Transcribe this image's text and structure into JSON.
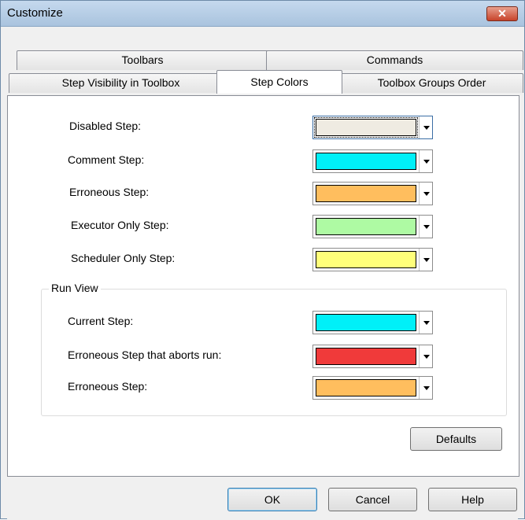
{
  "window": {
    "title": "Customize",
    "close_icon": "close-icon"
  },
  "tabs": {
    "row1": [
      {
        "label": "Toolbars"
      },
      {
        "label": "Commands"
      }
    ],
    "row2": [
      {
        "label": "Step Visibility in Toolbox"
      },
      {
        "label": "Step Colors",
        "active": true
      },
      {
        "label": "Toolbox Groups Order"
      }
    ]
  },
  "step_colors": [
    {
      "label": "Disabled Step:",
      "color": "#efebe2"
    },
    {
      "label": "Comment Step:",
      "color": "#00f0f8"
    },
    {
      "label": "Erroneous Step:",
      "color": "#ffbe5e"
    },
    {
      "label": "Executor Only Step:",
      "color": "#aefaa3"
    },
    {
      "label": "Scheduler Only Step:",
      "color": "#ffff7a"
    }
  ],
  "run_view": {
    "title": "Run View",
    "items": [
      {
        "label": "Current Step:",
        "color": "#00f0f8"
      },
      {
        "label": "Erroneous Step that aborts run:",
        "color": "#f03a3a"
      },
      {
        "label": "Erroneous Step:",
        "color": "#ffbe5e"
      }
    ]
  },
  "buttons": {
    "defaults": "Defaults",
    "ok": "OK",
    "cancel": "Cancel",
    "help": "Help"
  }
}
